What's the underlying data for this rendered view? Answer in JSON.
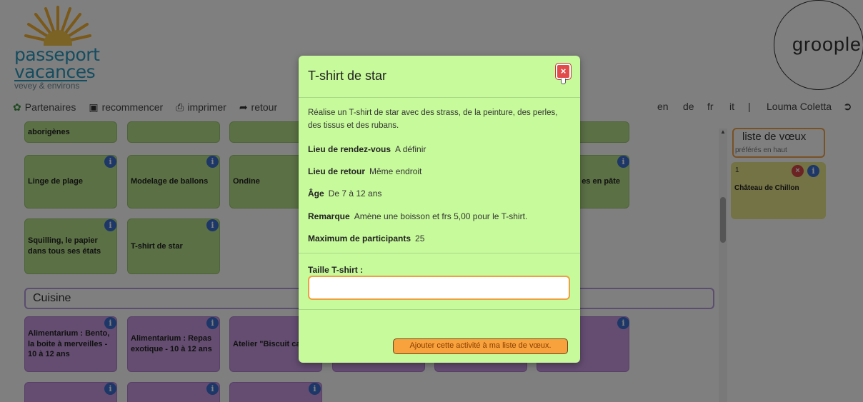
{
  "header": {
    "logo": {
      "line1": "passeport",
      "line2": "vacances",
      "line3": "vevey & environs"
    },
    "menu": [
      {
        "icon": "partners-icon",
        "label": "Partenaires"
      },
      {
        "icon": "trash-icon",
        "label": "recommencer"
      },
      {
        "icon": "printer-icon",
        "label": "imprimer"
      },
      {
        "icon": "back-arrow-icon",
        "label": "retour"
      }
    ],
    "languages": [
      "en",
      "de",
      "fr",
      "it"
    ],
    "separator": "|",
    "user": "Louma Coletta",
    "brand": "groople"
  },
  "tiles": [
    {
      "label": "aborigènes",
      "color": "green"
    },
    {
      "label": "Linge de plage",
      "color": "green"
    },
    {
      "label": "Modelage de ballons",
      "color": "green"
    },
    {
      "label": "Ondine",
      "color": "green"
    },
    {
      "label": "es en pâte",
      "color": "green"
    },
    {
      "label": "Squilling, le papier dans tous ses états",
      "color": "green"
    },
    {
      "label": "T-shirt de star",
      "color": "green"
    },
    {
      "label": "Alimentarium : Bento, la boite à merveilles - 10 à 12 ans",
      "color": "purple"
    },
    {
      "label": "Alimentarium : Repas exotique - 10 à 12 ans",
      "color": "purple"
    },
    {
      "label": "Atelier \"Biscuit ca",
      "color": "purple"
    }
  ],
  "section": {
    "title": "Cuisine"
  },
  "wishlist": {
    "title": "liste de vœux",
    "subtitle": "préférés en haut",
    "items": [
      {
        "rank": "1",
        "name": "Château de Chillon"
      }
    ]
  },
  "modal": {
    "title": "T-shirt de star",
    "description": "Réalise un T-shirt de star avec des strass, de la peinture, des perles, des tissus et des rubans.",
    "fields": [
      {
        "label": "Lieu de rendez-vous",
        "value": "A définir"
      },
      {
        "label": "Lieu de retour",
        "value": "Même endroit"
      },
      {
        "label": "Âge",
        "value": "De 7 à 12 ans"
      },
      {
        "label": "Remarque",
        "value": "Amène une boisson et frs 5,00 pour le T-shirt."
      },
      {
        "label": "Maximum de participants",
        "value": "25"
      }
    ],
    "size_label": "Taille T-shirt :",
    "size_value": "",
    "add_button": "Ajouter cette activité à ma liste de vœux."
  },
  "colors": {
    "modal_bg": "#c7fa9b",
    "tile_green": "#b6e08a",
    "tile_purple": "#c99be3",
    "accent_orange": "#f7a23d",
    "info_blue": "#3b6fd0",
    "logo_blue": "#2b9bc1"
  }
}
